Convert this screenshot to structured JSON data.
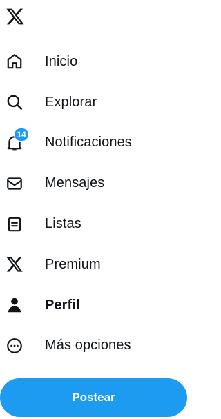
{
  "nav": {
    "items": [
      {
        "label": "Inicio",
        "icon": "home-icon"
      },
      {
        "label": "Explorar",
        "icon": "search-icon"
      },
      {
        "label": "Notificaciones",
        "icon": "bell-icon",
        "badge": "14"
      },
      {
        "label": "Mensajes",
        "icon": "envelope-icon"
      },
      {
        "label": "Listas",
        "icon": "list-icon"
      },
      {
        "label": "Premium",
        "icon": "x-logo-icon"
      },
      {
        "label": "Perfil",
        "icon": "person-icon",
        "active": true
      },
      {
        "label": "Más opciones",
        "icon": "more-circle-icon"
      }
    ]
  },
  "post_button": {
    "label": "Postear"
  },
  "colors": {
    "accent": "#1d9bf0",
    "text": "#0f1419",
    "background": "#ffffff"
  }
}
